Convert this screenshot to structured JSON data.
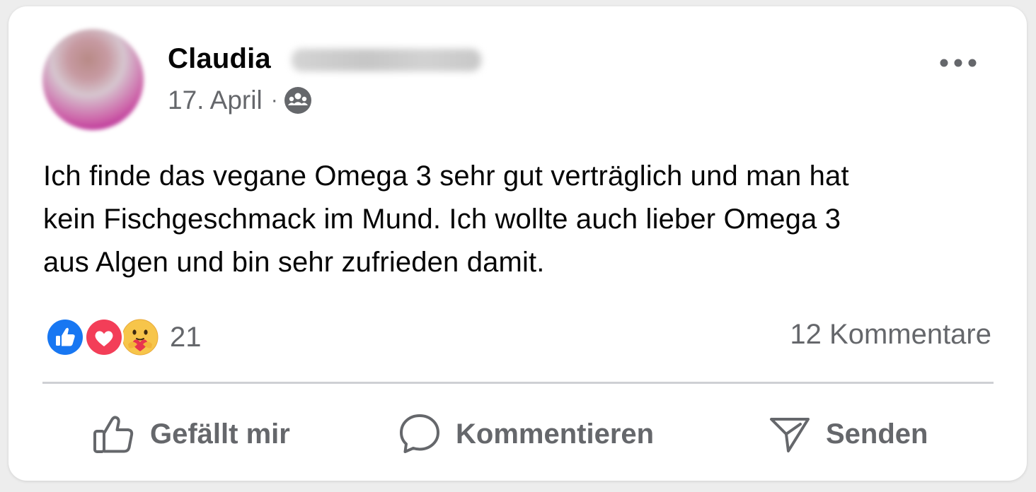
{
  "post": {
    "author": {
      "first_name": "Claudia",
      "last_name_blurred": "Mustermann"
    },
    "date": "17. April",
    "separator": "·",
    "audience_icon": "group-audience-icon",
    "more_icon": "more-options-icon",
    "text": "Ich finde das vegane Omega 3 sehr gut verträglich und man hat\nkein Fischgeschmack im Mund.  Ich wollte auch lieber Omega 3\naus Algen und bin sehr zufrieden damit."
  },
  "engagement": {
    "reaction_icons": [
      "like-reaction-icon",
      "love-reaction-icon",
      "care-reaction-icon"
    ],
    "reaction_count": "21",
    "comments_label": "12 Kommentare"
  },
  "actions": {
    "like_label": "Gefällt mir",
    "comment_label": "Kommentieren",
    "send_label": "Senden"
  },
  "colors": {
    "primary_text": "#050505",
    "secondary_text": "#65676b",
    "like_blue": "#1877f2",
    "love_red": "#f33e58",
    "divider": "#ced0d4"
  }
}
